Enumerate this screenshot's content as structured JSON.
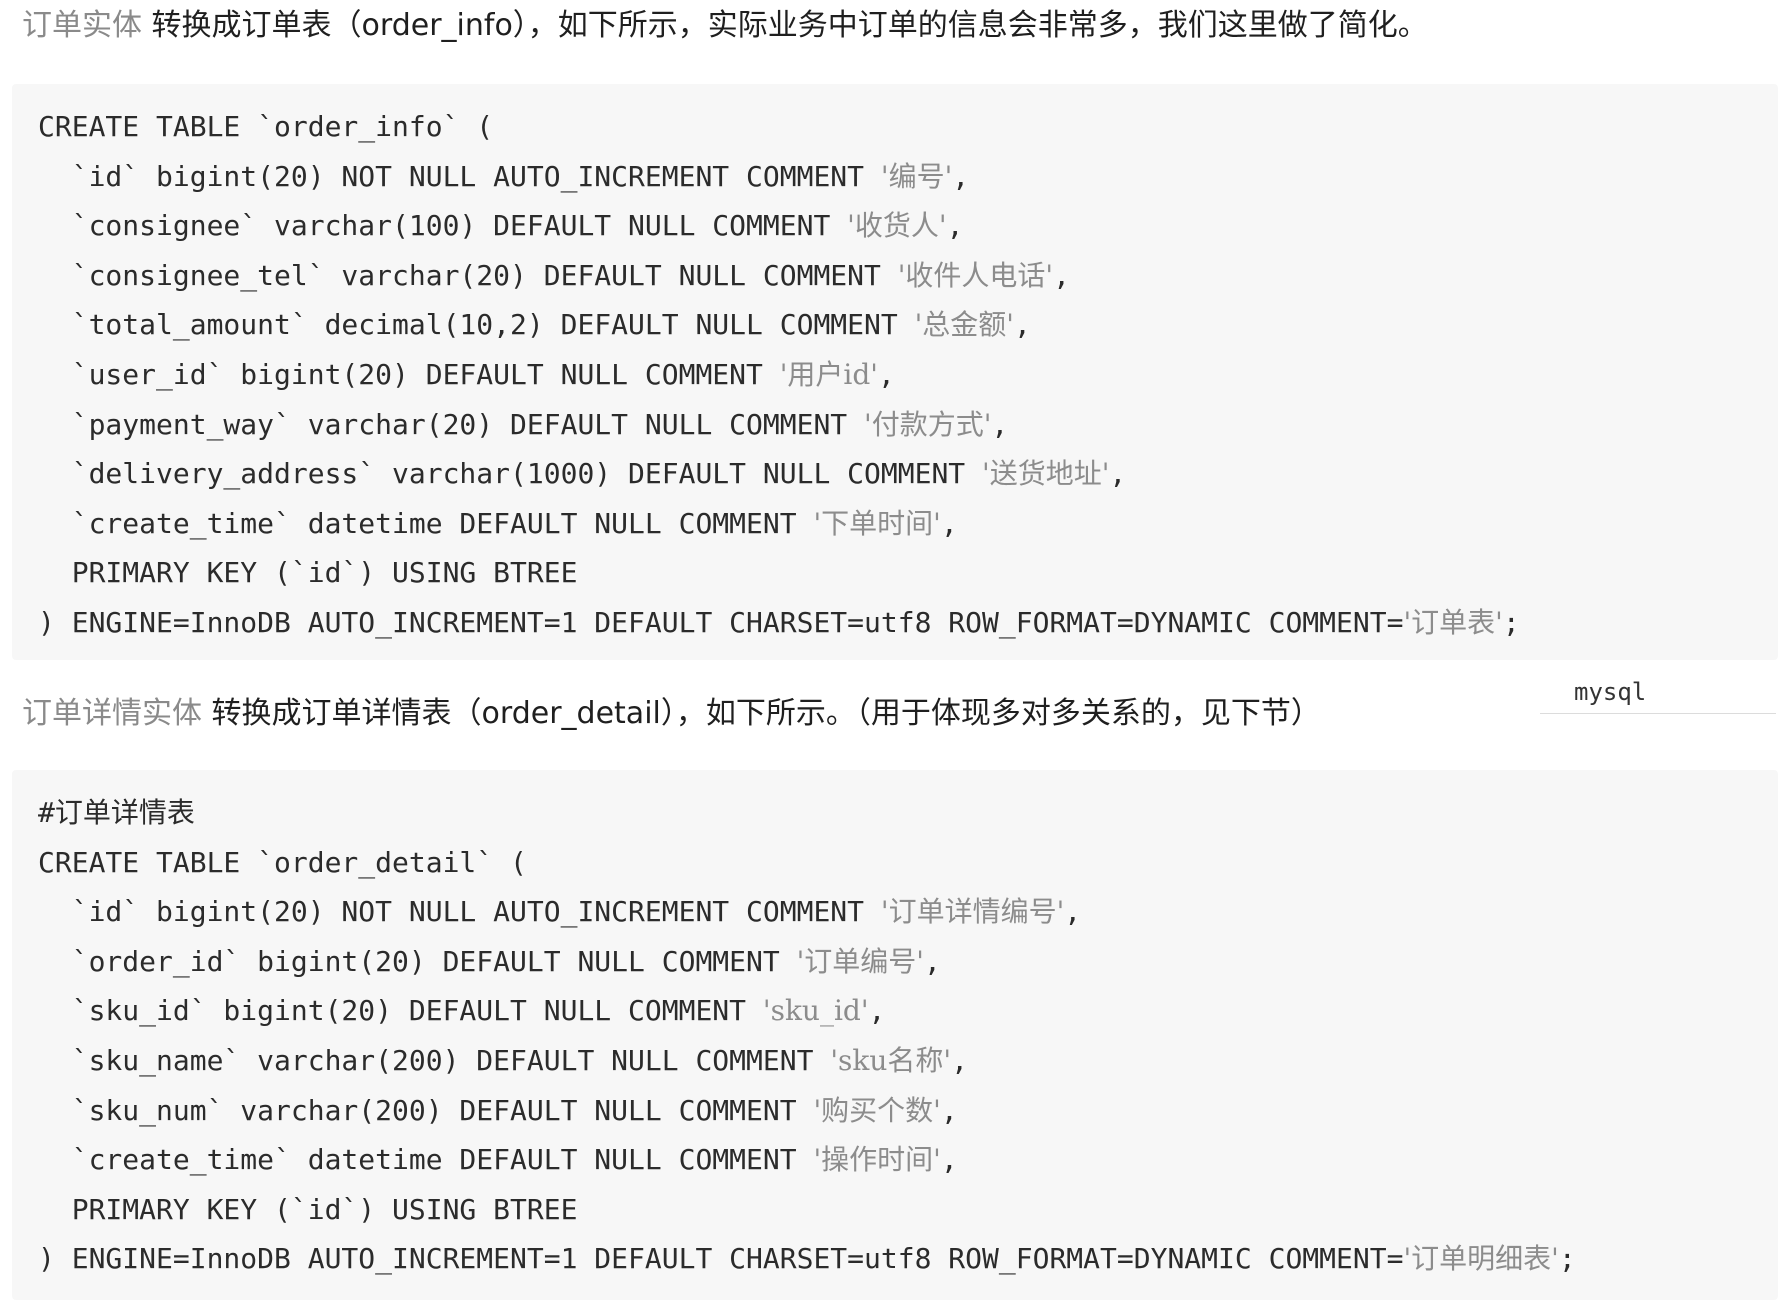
{
  "section1": {
    "lead": "订单实体",
    "text": "转换成订单表（order_info），如下所示，实际业务中订单的信息会非常多，我们这里做了简化。"
  },
  "code1": [
    "CREATE TABLE `order_info` (",
    "  `id` bigint(20) NOT NULL AUTO_INCREMENT COMMENT '编号',",
    "  `consignee` varchar(100) DEFAULT NULL COMMENT '收货人',",
    "  `consignee_tel` varchar(20) DEFAULT NULL COMMENT '收件人电话',",
    "  `total_amount` decimal(10,2) DEFAULT NULL COMMENT '总金额',",
    "  `user_id` bigint(20) DEFAULT NULL COMMENT '用户id',",
    "  `payment_way` varchar(20) DEFAULT NULL COMMENT '付款方式',",
    "  `delivery_address` varchar(1000) DEFAULT NULL COMMENT '送货地址',",
    "  `create_time` datetime DEFAULT NULL COMMENT '下单时间',",
    "  PRIMARY KEY (`id`) USING BTREE",
    ") ENGINE=InnoDB AUTO_INCREMENT=1 DEFAULT CHARSET=utf8 ROW_FORMAT=DYNAMIC COMMENT='订单表';"
  ],
  "code1_lang": "mysql",
  "section2": {
    "lead": "订单详情实体",
    "text": "转换成订单详情表（order_detail），如下所示。（用于体现多对多关系的，见下节）"
  },
  "code2": [
    "#订单详情表",
    "CREATE TABLE `order_detail` (",
    "  `id` bigint(20) NOT NULL AUTO_INCREMENT COMMENT '订单详情编号',",
    "  `order_id` bigint(20) DEFAULT NULL COMMENT '订单编号',",
    "  `sku_id` bigint(20) DEFAULT NULL COMMENT 'sku_id',",
    "  `sku_name` varchar(200) DEFAULT NULL COMMENT 'sku名称',",
    "  `sku_num` varchar(200) DEFAULT NULL COMMENT '购买个数',",
    "  `create_time` datetime DEFAULT NULL COMMENT '操作时间',",
    "  PRIMARY KEY (`id`) USING BTREE",
    ") ENGINE=InnoDB AUTO_INCREMENT=1 DEFAULT CHARSET=utf8 ROW_FORMAT=DYNAMIC COMMENT='订单明细表';"
  ]
}
